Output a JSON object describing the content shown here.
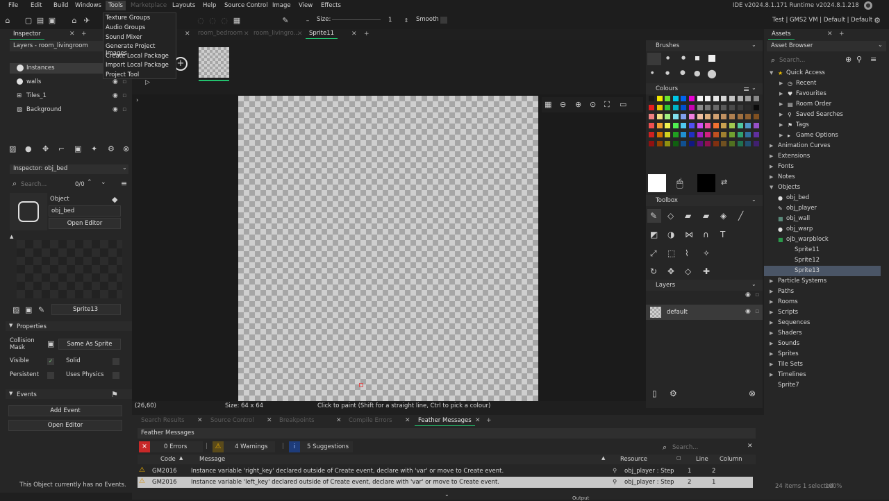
{
  "menu": {
    "items": [
      "File",
      "Edit",
      "Build",
      "Windows",
      "Tools",
      "Marketplace",
      "Layouts",
      "Help",
      "Source Control",
      "Image",
      "View",
      "Effects"
    ],
    "right_status": "IDE v2024.8.1.171  Runtime v2024.8.1.218",
    "active": "Tools",
    "disabled": "Marketplace"
  },
  "tools_menu": [
    "Texture Groups",
    "Audio Groups",
    "Sound Mixer",
    "Generate Project Images",
    "Create Local Package",
    "Import Local Package",
    "Project Tool"
  ],
  "toolbar": {
    "size_label": "Size:",
    "size_value": "1",
    "smooth_label": "Smooth",
    "target": "Test | GMS2 VM | Default | Default"
  },
  "tabs": {
    "inspector": "Inspector",
    "room_bedroom": "room_bedroom",
    "room_living": "room_livingro...",
    "sprite": "Sprite11",
    "assets": "Assets"
  },
  "layers_panel": {
    "title": "Layers - room_livingroom",
    "layers": [
      "Instances",
      "walls",
      "Tiles_1",
      "Background"
    ]
  },
  "inspector": {
    "title": "Inspector: obj_bed",
    "search_placeholder": "Search...",
    "search_count": "0/0",
    "object_label": "Object",
    "object_name": "obj_bed",
    "open_editor": "Open Editor",
    "sprite_name": "Sprite13",
    "properties_header": "Properties",
    "collision_mask": "Collision Mask",
    "same_as_sprite": "Same As Sprite",
    "visible": "Visible",
    "solid": "Solid",
    "persistent": "Persistent",
    "uses_physics": "Uses Physics",
    "events_header": "Events",
    "add_event": "Add Event",
    "open_editor2": "Open Editor",
    "no_events": "This Object currently has no Events."
  },
  "canvas_status": {
    "coords": "(26,60)",
    "size": "Size: 64 x 64",
    "hint": "Click to paint (Shift for a straight line, Ctrl to pick a colour)"
  },
  "right_tools": {
    "brushes": "Brushes",
    "colours": "Colours",
    "toolbox": "Toolbox",
    "layers": "Layers",
    "default_layer": "default"
  },
  "palette_colors": [
    "#1a1a1a",
    "#f2e600",
    "#6ee62e",
    "#00c8e6",
    "#0064f0",
    "#e600d2",
    "#f2f2f2",
    "#f2f2f2",
    "#e6e6e6",
    "#d6d6d6",
    "#c4c4c4",
    "#b0b0b0",
    "#9c9c9c",
    "#888888",
    "#e61e1e",
    "#e6c800",
    "#32c832",
    "#00b4c8",
    "#0050d2",
    "#c800b4",
    "#8c8c8c",
    "#7a7a7a",
    "#6a6a6a",
    "#5a5a5a",
    "#4a4a4a",
    "#3a3a3a",
    "#2a2a2a",
    "#0a0a0a",
    "#f08080",
    "#f0e080",
    "#a0f080",
    "#80e0f0",
    "#80a0f0",
    "#f080e0",
    "#f0c0a0",
    "#e0b080",
    "#d0a070",
    "#c09060",
    "#b08050",
    "#a07040",
    "#906030",
    "#805020",
    "#f05050",
    "#f0a030",
    "#f0f050",
    "#50f050",
    "#50c8f0",
    "#5050f0",
    "#d050f0",
    "#f050a0",
    "#f07030",
    "#c8a050",
    "#a0c850",
    "#50c8a0",
    "#5096c8",
    "#9650c8",
    "#d02020",
    "#d07000",
    "#d0d020",
    "#20a020",
    "#2090d0",
    "#2030c0",
    "#a020c0",
    "#d02080",
    "#c05020",
    "#a08030",
    "#70a030",
    "#30a070",
    "#3070a0",
    "#6030a0",
    "#901010",
    "#904000",
    "#909010",
    "#106010",
    "#105090",
    "#101880",
    "#601080",
    "#901050",
    "#803010",
    "#705020",
    "#507020",
    "#207050",
    "#205070",
    "#402070"
  ],
  "assets": {
    "title": "Asset Browser",
    "search_placeholder": "Search...",
    "quick_access": "Quick Access",
    "quick_items": [
      "Recent",
      "Favourites",
      "Room Order",
      "Saved Searches",
      "Tags",
      "Game Options"
    ],
    "folders_top": [
      "Animation Curves",
      "Extensions",
      "Fonts",
      "Notes",
      "Objects"
    ],
    "objects": [
      "obj_bed",
      "obj_player",
      "obj_wall",
      "obj_warp",
      "ojb_warpblock",
      "Sprite11",
      "Sprite12",
      "Sprite13"
    ],
    "folders_bottom": [
      "Particle Systems",
      "Paths",
      "Rooms",
      "Scripts",
      "Sequences",
      "Shaders",
      "Sounds",
      "Sprites",
      "Tile Sets",
      "Timelines",
      "Sprite7"
    ],
    "footer": "24 items   1 selected"
  },
  "output": {
    "tabs": [
      "Search Results",
      "Source Control",
      "Breakpoints",
      "Compile Errors",
      "Feather Messages"
    ],
    "panel_title": "Feather Messages",
    "errors": "0 Errors",
    "warnings": "4 Warnings",
    "suggestions": "5 Suggestions",
    "search_placeholder": "Search...",
    "columns": [
      "Code",
      "Message",
      "Resource",
      "Line",
      "Column"
    ],
    "rows": [
      {
        "code": "GM2016",
        "message": "Instance variable 'right_key' declared outside of Create event, declare with 'var' or move to Create event.",
        "resource": "obj_player : Step",
        "line": "1",
        "column": "2"
      },
      {
        "code": "GM2016",
        "message": "Instance variable 'left_key' declared outside of Create event, declare with 'var' or move to Create event.",
        "resource": "obj_player : Step",
        "line": "2",
        "column": "1"
      }
    ],
    "output_label": "Output",
    "zoom": "100%"
  }
}
